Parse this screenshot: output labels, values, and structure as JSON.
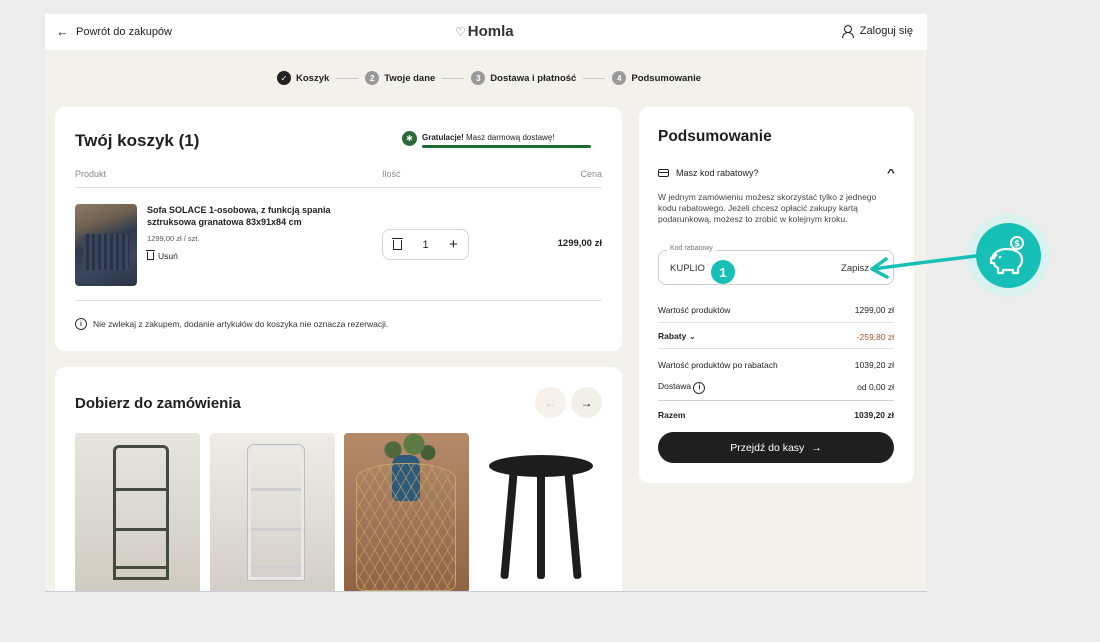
{
  "header": {
    "back_label": "Powrót do zakupów",
    "logo_text": "Homla",
    "login_label": "Zaloguj się"
  },
  "steps": [
    {
      "num": "✓",
      "label": "Koszyk",
      "done": true
    },
    {
      "num": "2",
      "label": "Twoje dane"
    },
    {
      "num": "3",
      "label": "Dostawa i płatność"
    },
    {
      "num": "4",
      "label": "Podsumowanie"
    }
  ],
  "cart": {
    "title": "Twój koszyk (1)",
    "congrats_bold": "Gratulacje!",
    "congrats_text": " Masz darmową dostawę!",
    "col_product": "Produkt",
    "col_qty": "Ilość",
    "col_price": "Cena",
    "item": {
      "name": "Sofa SOLACE 1-osobowa, z funkcją spania sztruksowa granatowa 83x91x84 cm",
      "unit_price": "1299,00 zł / szt.",
      "remove_label": "Usuń",
      "qty": "1",
      "price": "1299,00 zł"
    },
    "note": "Nie zwlekaj z zakupem, dodanie artykułów do koszyka nie oznacza rezerwacji."
  },
  "reco": {
    "title": "Dobierz do zamówienia",
    "prev": "←",
    "next": "→"
  },
  "summary": {
    "title": "Podsumowanie",
    "promo_toggle": "Masz kod rabatowy?",
    "promo_desc": "W jednym zamówieniu możesz skorzystać tylko z jednego kodu rabatowego. Jeżeli chcesz opłacić zakupy kartą podarunkową, możesz to zrobić w kolejnym kroku.",
    "code_label": "Kod rabatowy",
    "code_value": "KUPLIO",
    "save_label": "Zapisz",
    "rows": [
      {
        "label": "Wartość produktów",
        "value": "1299,00 zł"
      },
      {
        "label": "Rabaty",
        "value": "-259,80 zł"
      },
      {
        "label": "Wartość produktów po rabatach",
        "value": "1039,20 zł"
      },
      {
        "label": "Dostawa",
        "value": "od 0,00 zł"
      },
      {
        "label": "Razem",
        "value": "1039,20 zł"
      }
    ],
    "checkout_label": "Przejdź do kasy"
  },
  "callout": {
    "badge": "1",
    "accent": "#17c0b6"
  }
}
